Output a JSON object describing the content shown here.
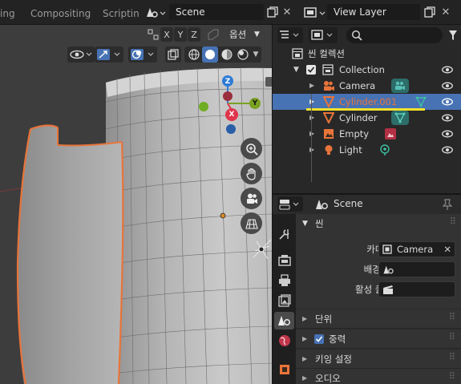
{
  "topbar": {
    "tabs": [
      "ing",
      "Compositing",
      "Scriptin"
    ],
    "scene_name": "Scene",
    "view_layer_name": "View Layer"
  },
  "viewport": {
    "axis_buttons": [
      "X",
      "Y",
      "Z"
    ],
    "options_label": "옵션",
    "gizmo_axes": [
      "Z",
      "Y",
      "X"
    ]
  },
  "outliner": {
    "search_placeholder": "",
    "items": [
      {
        "label": "씬 컬렉션"
      },
      {
        "label": "Collection"
      },
      {
        "label": "Camera"
      },
      {
        "label": "Cylinder.001",
        "color": "#e8743a"
      },
      {
        "label": "Cylinder"
      },
      {
        "label": "Empty"
      },
      {
        "label": "Light"
      }
    ]
  },
  "properties": {
    "context_label": "Scene",
    "section_scene": "씬",
    "camera_label": "카메라",
    "camera_value": "Camera",
    "background_scene_label": "배경 씬",
    "active_clip_label": "활성 클립",
    "sections": [
      "단위",
      "중력",
      "키잉 설정",
      "오디오"
    ]
  },
  "colors": {
    "accent": "#4772b3",
    "selected_object": "#e8743a",
    "highlight_line": "#f2e22b",
    "axis_x": "#e0344c",
    "axis_y": "#7ba123",
    "axis_z": "#2f7bd6"
  }
}
